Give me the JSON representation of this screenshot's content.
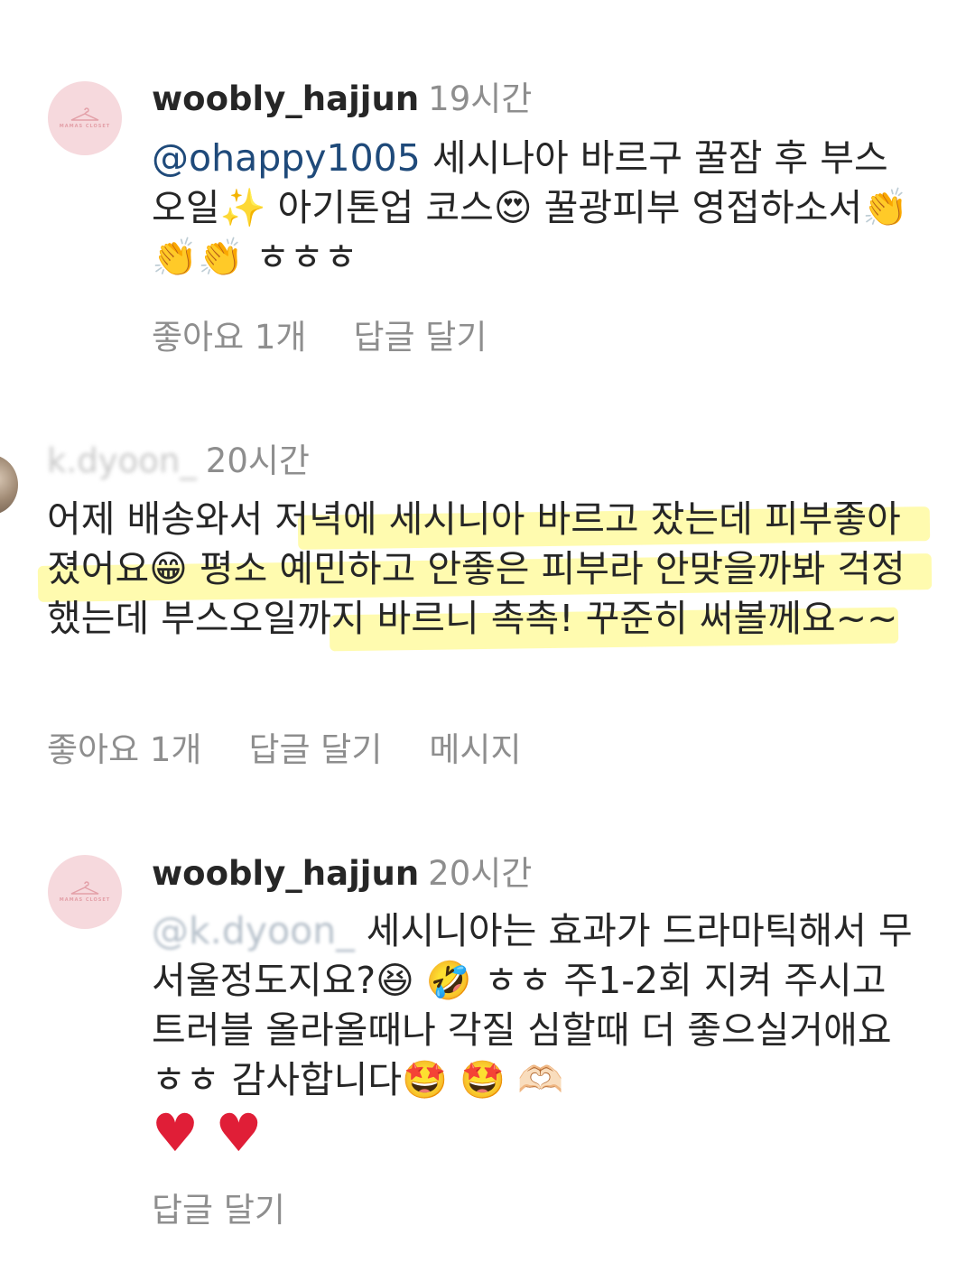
{
  "comments": [
    {
      "username": "woobly_hajjun",
      "time": "19시간",
      "mention": "@ohappy1005",
      "text": " 세시나아 바르구 꿀잠 후 부스오일✨ 아기톤업 코스😍 꿀광피부 영접하소서👏👏👏 ㅎㅎㅎ",
      "likes": "좋아요 1개",
      "reply": "답글 달기"
    },
    {
      "username": "k.dyoon_",
      "time": "20시간",
      "text": "어제 배송와서 저녁에 세시니아 바르고 잤는데 피부좋아졌어요😁 평소 예민하고 안좋은 피부라 안맞을까봐 걱정했는데 부스오일까지 바르니 촉촉! 꾸준히 써볼께요~~",
      "likes": "좋아요 1개",
      "reply": "답글 달기",
      "message": "메시지"
    },
    {
      "username": "woobly_hajjun",
      "time": "20시간",
      "mention": "@k.dyoon_",
      "text": " 세시니아는 효과가 드라마틱해서 무서울정도지요?😆 🤣 ㅎㅎ 주1-2회 지켜 주시고 트러블 올라올때나 각질 심할때 더 좋으실거애요 ㅎㅎ 감사합니다🤩 🤩 🫶🏻",
      "hearts": "♥ ♥",
      "reply": "답글 달기"
    }
  ],
  "avatar_brand": "MAMAS CLOSET"
}
